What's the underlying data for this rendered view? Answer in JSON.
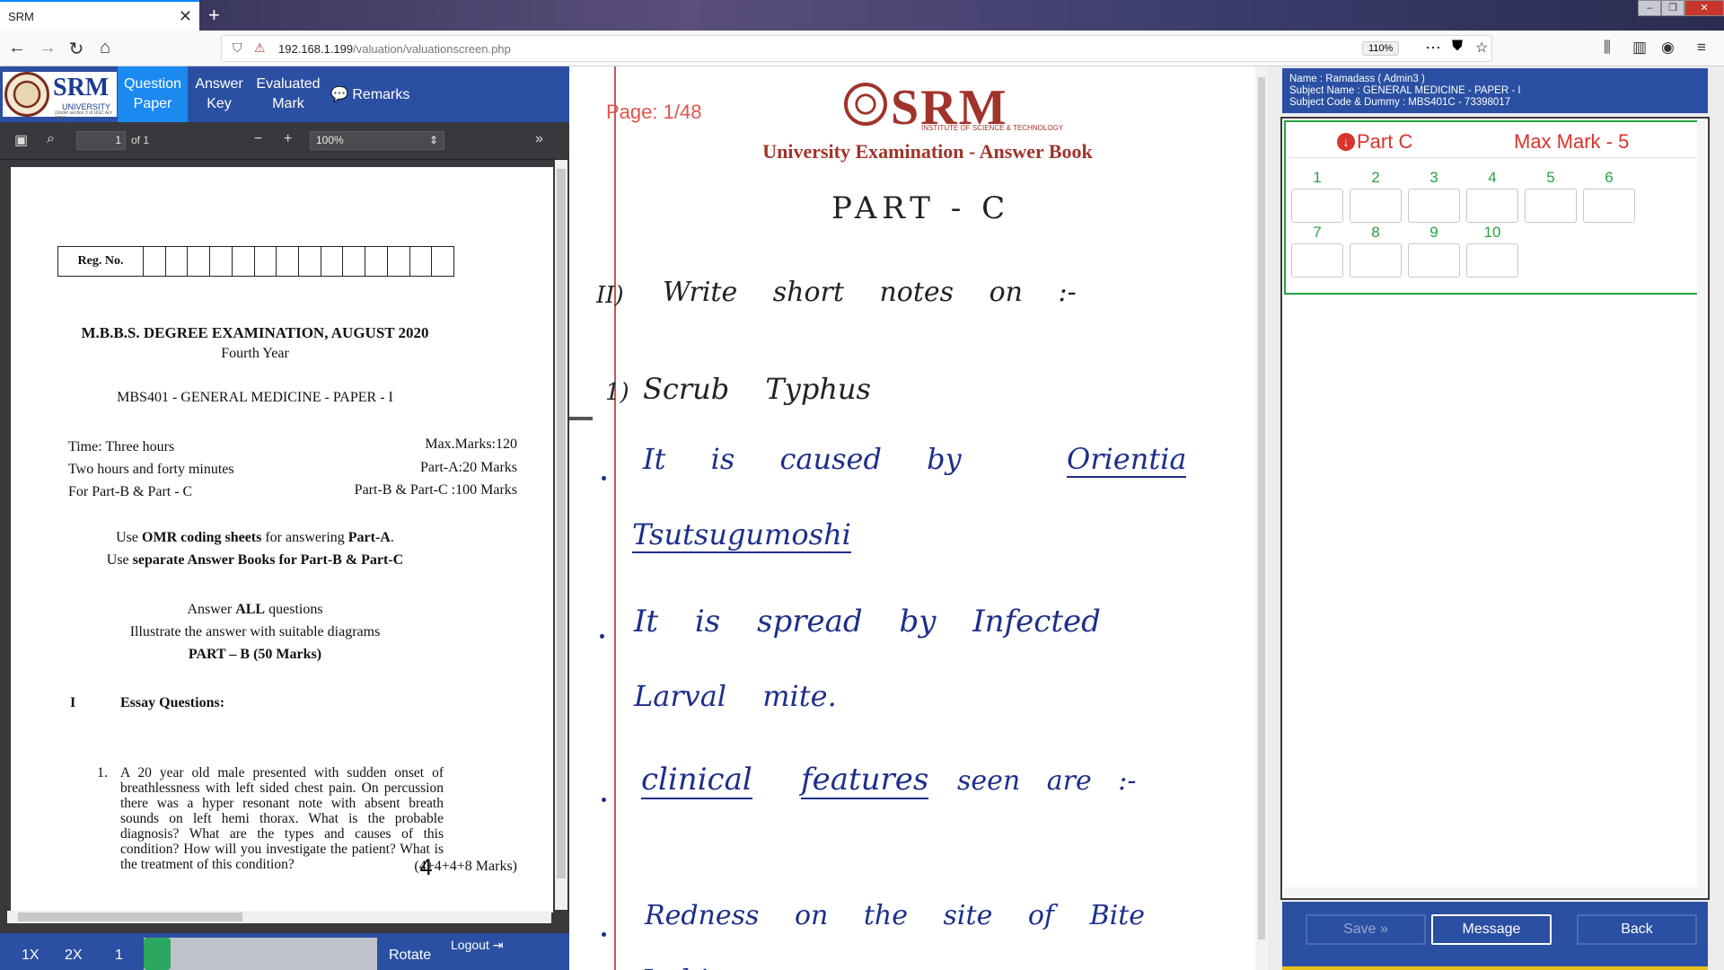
{
  "browser": {
    "tab_title": "SRM",
    "tab_close": "✕",
    "new_tab": "+",
    "url_host": "192.168.1.199",
    "url_path": "/valuation/valuationscreen.php",
    "zoom": "110%"
  },
  "left_header": {
    "logo_name": "SRM",
    "logo_sub": "UNIVERSITY",
    "logo_small": "(Under section 3 of UGC Act 1956)",
    "buttons": [
      {
        "line1": "Question",
        "line2": "Paper"
      },
      {
        "line1": "Answer",
        "line2": "Key"
      },
      {
        "line1": "Evaluated",
        "line2": "Mark"
      }
    ],
    "remarks_label": "Remarks"
  },
  "pdf_toolbar": {
    "page_value": "1",
    "page_of": "of 1",
    "zoom": "100%"
  },
  "question_paper": {
    "reg_label": "Reg. No.",
    "exam_title": "M.B.B.S. DEGREE EXAMINATION, AUGUST 2020",
    "year": "Fourth Year",
    "subject": "MBS401 - GENERAL MEDICINE - PAPER - I",
    "time_label": "Time: Three hours",
    "time_line2": "Two hours and forty minutes",
    "time_line3": "For Part-B & Part - C",
    "max_marks": "Max.Marks:120",
    "part_a_marks": "Part-A:20 Marks",
    "part_bc_marks": "Part-B & Part-C :100 Marks",
    "omr_pre": "Use ",
    "omr_bold": "OMR coding sheets",
    "omr_mid": " for answering ",
    "omr_part": "Part-A",
    "omr_end": ".",
    "sep_pre": "Use ",
    "sep_bold": "separate Answer Books for Part-B & Part-C",
    "answer_pre": "Answer ",
    "answer_bold": "ALL",
    "answer_post": " questions",
    "illustrate": "Illustrate the answer with suitable diagrams",
    "part_b": "PART – B (50 Marks)",
    "section_num": "I",
    "section_title": "Essay Questions:",
    "q1_num": "1.",
    "q1_text": "A 20 year old male presented with sudden onset of breathlessness with left sided chest pain. On percussion there was a hyper resonant note with absent breath sounds on left hemi thorax. What is the probable diagnosis? What are the types and causes of this condition? How will you investigate the patient? What is the treatment of this condition?",
    "q1_marks": "(4+4+4+8 Marks)",
    "handwritten_mark": "4"
  },
  "left_bottom": {
    "b1x": "1X",
    "b2x": "2X",
    "b1": "1",
    "rotate": "Rotate",
    "logout": "Logout"
  },
  "answer_book": {
    "page": "Page: 1/48",
    "logo_word": "SRM",
    "logo_tag": "INSTITUTE OF SCIENCE & TECHNOLOGY",
    "title": "University Examination - Answer Book",
    "heading": "PART - C",
    "q_label": "II)",
    "q_text": "Write short notes on :-",
    "sub_num": "1)",
    "sub_title": "Scrub Typhus",
    "l1a": "It is caused by",
    "l1b": "Orientia",
    "l2": "Tsutsugumoshi",
    "l3": "It is spread by Infected",
    "l4": "Larval mite.",
    "l5a": "clinical",
    "l5b": "features",
    "l5c": "seen are :-",
    "l6": "Redness on the site of Bite",
    "l7": "Itching"
  },
  "right_panel": {
    "name_line": "Name : Ramadass ( Admin3 )",
    "subject_line": "Subject Name : GENERAL MEDICINE - PAPER - I",
    "code_line": "Subject Code & Dummy : MBS401C - 73398017",
    "part_label": "Part C",
    "max_mark": "Max Mark - 5",
    "questions": [
      "1",
      "2",
      "3",
      "4",
      "5",
      "6",
      "7",
      "8",
      "9",
      "10"
    ],
    "save": "Save »",
    "message": "Message",
    "back": "Back"
  },
  "colors": {
    "brand_blue": "#2b4fa2",
    "active_blue": "#1b8af0",
    "green": "#27a243",
    "red": "#d9342b",
    "ink": "#1d2f8a"
  }
}
